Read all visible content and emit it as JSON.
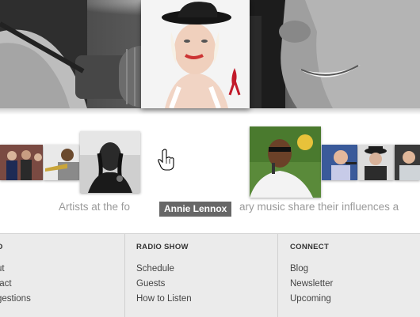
{
  "carousel": {
    "featured_artist": "Annie Lennox",
    "tagline_left": "Artists at the fo",
    "tagline_right": "ary music share their influences a"
  },
  "footer": {
    "col1": {
      "heading": "O",
      "links": [
        "ut",
        "tact",
        "gestions"
      ]
    },
    "col2": {
      "heading": "RADIO SHOW",
      "links": [
        "Schedule",
        "Guests",
        "How to Listen"
      ]
    },
    "col3": {
      "heading": "CONNECT",
      "links": [
        "Blog",
        "Newsletter",
        "Upcoming"
      ]
    }
  },
  "icons": {
    "cursor": "hand-pointer-icon"
  },
  "colors": {
    "footer_bg": "#ebebeb",
    "caption_bg": "#464646",
    "tagline": "#9a9a9a"
  }
}
